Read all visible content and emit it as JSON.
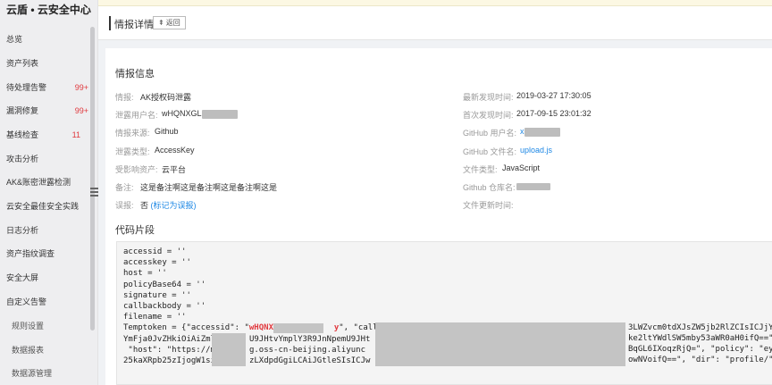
{
  "sidebar": {
    "brand": "云盾 • 云安全中心",
    "items": [
      {
        "label": "总览",
        "badge": ""
      },
      {
        "label": "资产列表",
        "badge": ""
      },
      {
        "label": "待处理告警",
        "badge": "99+"
      },
      {
        "label": "漏洞修复",
        "badge": "99+"
      },
      {
        "label": "基线检查",
        "badge": "11"
      },
      {
        "label": "攻击分析",
        "badge": ""
      },
      {
        "label": "AK&账密泄露检测",
        "badge": ""
      },
      {
        "label": "云安全最佳安全实践",
        "badge": ""
      },
      {
        "label": "日志分析",
        "badge": ""
      },
      {
        "label": "资产指纹调查",
        "badge": ""
      },
      {
        "label": "安全大屏",
        "badge": ""
      },
      {
        "label": "自定义告警",
        "badge": ""
      }
    ],
    "subitems": [
      "规则设置",
      "数据报表",
      "数据源管理"
    ]
  },
  "header": {
    "title": "情报详情",
    "back_label": "返回"
  },
  "info": {
    "section_title": "情报信息",
    "left": [
      {
        "label": "情报:",
        "value": "AK授权码泄露"
      },
      {
        "label": "泄露用户名:",
        "value": "wHQNXGL"
      },
      {
        "label": "情报来源:",
        "value": "Github"
      },
      {
        "label": "泄露类型:",
        "value": "AccessKey"
      },
      {
        "label": "受影响资产:",
        "value": "云平台"
      },
      {
        "label": "备注:",
        "value": "这是备注啊这是备注啊这是备注啊这是"
      },
      {
        "label": "误报:",
        "value": "否",
        "link": "(标记为误报)"
      }
    ],
    "right": [
      {
        "label": "最新发现时间:",
        "value": "2019-03-27 17:30:05"
      },
      {
        "label": "首次发现时间:",
        "value": "2017-09-15 23:01:32"
      },
      {
        "label": "GitHub 用户名:",
        "value": "x"
      },
      {
        "label": "GitHub 文件名:",
        "value": "upload.js"
      },
      {
        "label": "文件类型:",
        "value": "JavaScript"
      },
      {
        "label": "Github 仓库名:",
        "value": ""
      },
      {
        "label": "文件更新时间:",
        "value": ""
      }
    ]
  },
  "code": {
    "section_title": "代码片段",
    "lines": [
      "accessid = ''",
      "accesskey = ''",
      "host = ''",
      "policyBase64 = ''",
      "signature = ''",
      "callbackbody = ''",
      "filename = ''"
    ],
    "token_prefix": "Temptoken = {\"accessid\": \"",
    "token_user": "wHQNXGL",
    "token_user_end": "y",
    "token_after": "\", \"callb",
    "token_tail": "3LWZvcm0tdXJsZW5jb2RlZCIsICJjY",
    "line9_start": "YmFja0JvZHkiOiAiZml",
    "line9_mid": "U9JHtvYmplY3R9JnNpemU9JHt",
    "line9_tail": "ke2ltYWdlSW5mby53aWR0aH0ifQ==\"",
    "line10_start": " \"host\": \"https://m",
    "line10_mid": "g.oss-cn-beijing.aliyunc",
    "line10_tail": "BqGL6IXoqzRjQ=\", \"policy\": \"ey",
    "line11_start": "25kaXRpb25zIjogW1si",
    "line11_mid": "zLXdpdGgiLCAiJGtleSIsICJw",
    "line11_tail": "owNVoifQ==\", \"dir\": \"profile/\""
  }
}
